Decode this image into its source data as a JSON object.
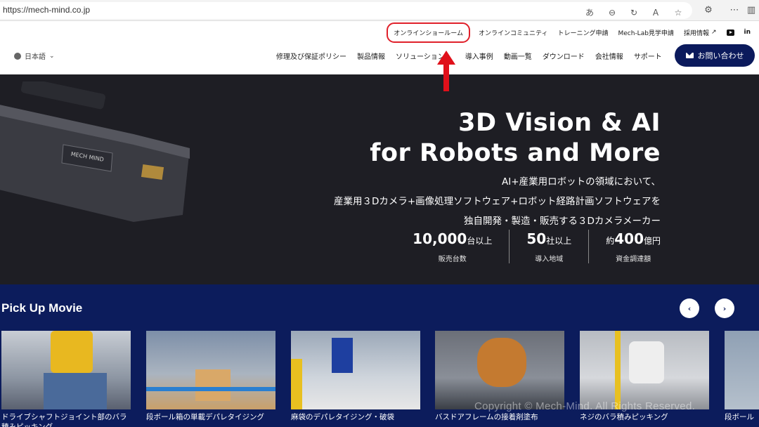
{
  "browser": {
    "url": "https://mech-mind.co.jp",
    "icons": [
      "read-aloud-icon",
      "zoom-out-icon",
      "refresh-icon",
      "text-size-icon",
      "favorite-star-icon",
      "extensions-icon",
      "more-menu-icon",
      "sidebar-icon"
    ]
  },
  "header": {
    "top_links": [
      "オンラインショールーム",
      "オンラインコミュニティ",
      "トレーニング申請",
      "Mech-Lab見学申請",
      "採用情報"
    ],
    "language": "日本語",
    "nav": [
      "修理及び保証ポリシー",
      "製品情報",
      "ソリューション",
      "導入事例",
      "動画一覧",
      "ダウンロード",
      "会社情報",
      "サポート"
    ],
    "contact_label": "お問い合わせ",
    "linkedin_label": "in",
    "highlight_color": "#e0202a",
    "brand_color": "#0b1a5c"
  },
  "hero": {
    "title_line1": "3D Vision & AI",
    "title_line2": "for Robots and More",
    "sub_line1": "AI+産業用ロボットの領域において、",
    "sub_line2": "産業用３Dカメラ+画像処理ソフトウェア+ロボット経路計画ソフトウェアを",
    "sub_line3": "独自開発・製造・販売する３Dカメラメーカー",
    "camera_logo": "MECH MIND",
    "stats": [
      {
        "prefix": "",
        "value": "10,000",
        "suffix": "台以上",
        "label": "販売台数"
      },
      {
        "prefix": "",
        "value": "50",
        "suffix": "社以上",
        "label": "導入地域"
      },
      {
        "prefix": "約",
        "value": "400",
        "suffix": "億円",
        "label": "資金調達額"
      }
    ]
  },
  "movies": {
    "heading": "Pick Up Movie",
    "prev_label": "‹",
    "next_label": "›",
    "cards": [
      {
        "title": "ドライブシャフトジョイント部のバラ積みピッキング"
      },
      {
        "title": "段ボール箱の単載デパレタイジング"
      },
      {
        "title": "麻袋のデパレタイジング・破袋"
      },
      {
        "title": "バスドアフレームの接着剤塗布"
      },
      {
        "title": "ネジのバラ積みピッキング"
      },
      {
        "title": "段ボール"
      }
    ],
    "watermark": "Copyright © Mech-Mind. All Rights Reserved."
  }
}
